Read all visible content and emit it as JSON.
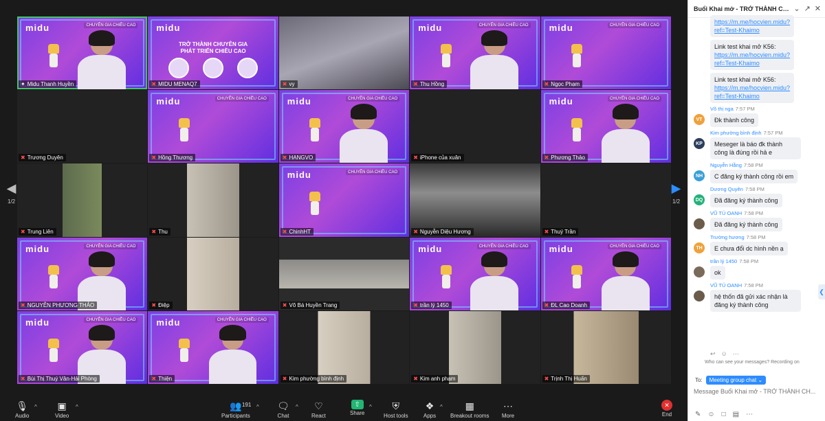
{
  "tiles": [
    {
      "name": "Midu Thanh Huyền",
      "style": "midu",
      "muted": false,
      "pin": true
    },
    {
      "name": "MIDU MENAQ7",
      "style": "poster",
      "muted": false
    },
    {
      "name": "vy",
      "style": "cam1",
      "muted": true
    },
    {
      "name": "Thu Hồng",
      "style": "midu",
      "muted": true
    },
    {
      "name": "Ngọc Phạm",
      "style": "midu",
      "muted": true
    },
    {
      "name": "Trương Duyên",
      "style": "dark",
      "muted": true
    },
    {
      "name": "Hồng Thương",
      "style": "midu",
      "muted": true
    },
    {
      "name": "HANGVO",
      "style": "midu",
      "muted": true
    },
    {
      "name": "iPhone của xuân",
      "style": "dark",
      "muted": true
    },
    {
      "name": "Phương Thảo",
      "style": "midu",
      "muted": true
    },
    {
      "name": "Trung Liên",
      "style": "cam4",
      "muted": true
    },
    {
      "name": "Thu",
      "style": "cam5",
      "muted": true
    },
    {
      "name": "ChinhHT",
      "style": "midu",
      "muted": true
    },
    {
      "name": "Nguyễn Diệu Hương",
      "style": "cam2",
      "muted": true
    },
    {
      "name": "Thuý Trần",
      "style": "dark",
      "muted": true
    },
    {
      "name": "NGUYỄN PHƯƠNG THẢO",
      "style": "midu",
      "muted": true
    },
    {
      "name": "Điệp",
      "style": "cam6",
      "muted": true
    },
    {
      "name": "Võ Bá Huyền Trang",
      "style": "cam3",
      "muted": true
    },
    {
      "name": "trần lý 1450",
      "style": "midu",
      "muted": true
    },
    {
      "name": "ĐL Cao Doanh",
      "style": "midu",
      "muted": true
    },
    {
      "name": "Bùi Thị Thuý Vân-Hải Phòng",
      "style": "midu",
      "muted": true
    },
    {
      "name": "Thiện",
      "style": "midu",
      "muted": true
    },
    {
      "name": "Kim phường bình định",
      "style": "cam6",
      "muted": true
    },
    {
      "name": "Kim anh phạm",
      "style": "cam5",
      "muted": true
    },
    {
      "name": "Trịnh Thị Huấn",
      "style": "cam7",
      "muted": true
    }
  ],
  "poster": {
    "title_line1": "TRỞ THÀNH CHUYÊN GIA",
    "title_line2": "PHÁT TRIỂN CHIỀU CAO"
  },
  "brand": {
    "logo": "midu",
    "tag": "CHUYÊN GIA CHIỀU CAO"
  },
  "pager": {
    "left": "1/2",
    "right": "1/2"
  },
  "toolbar": {
    "audio": "Audio",
    "video": "Video",
    "participants": "Participants",
    "participants_count": "191",
    "chat": "Chat",
    "react": "React",
    "share": "Share",
    "host_tools": "Host tools",
    "apps": "Apps",
    "breakout": "Breakout rooms",
    "more": "More",
    "end": "End"
  },
  "chat": {
    "title": "Buổi Khai mở - TRỞ THÀNH CH...",
    "messages": [
      {
        "type": "link",
        "text": "",
        "link1": "https://m.me/hocvien.midu?",
        "link2": "ref=Test-Khaimo",
        "cont": true
      },
      {
        "type": "link",
        "text": "Link test khai mở K56:",
        "link1": "https://m.me/hocvien.midu?",
        "link2": "ref=Test-Khaimo",
        "cont": true
      },
      {
        "type": "link",
        "text": "Link test khai mở K56:",
        "link1": "https://m.me/hocvien.midu?",
        "link2": "ref=Test-Khaimo",
        "cont": true
      },
      {
        "sender": "Võ thị nga",
        "time": "7:57 PM",
        "initials": "VT",
        "color": "#f0a13a",
        "text": "Đk thành công"
      },
      {
        "sender": "Kim phường bình định",
        "time": "7:57 PM",
        "initials": "KP",
        "color": "#2b3e5c",
        "text": "Meseger là báo đk thành công là đúng rồi hả e"
      },
      {
        "sender": "Nguyễn Hằng",
        "time": "7:58 PM",
        "initials": "NH",
        "color": "#3aa0d8",
        "text": "C đăng ký thành công rồi em"
      },
      {
        "sender": "Dương Quyên",
        "time": "7:58 PM",
        "initials": "DQ",
        "color": "#24b27a",
        "text": "Đã đăng ký thành công"
      },
      {
        "sender": "VŨ TÚ OANH",
        "time": "7:58 PM",
        "initials": "",
        "color": "#6b5b4a",
        "text": "Đã đăng ký thành công"
      },
      {
        "sender": "Trường hương",
        "time": "7:58 PM",
        "initials": "TH",
        "color": "#f0a13a",
        "text": "E chưa đổi dc hình  nền ạ"
      },
      {
        "sender": "trần lý 1450",
        "time": "7:58 PM",
        "initials": "",
        "color": "#7a6a5a",
        "text": "ok"
      },
      {
        "sender": "VŨ TÚ OANH",
        "time": "7:58 PM",
        "initials": "",
        "color": "#6b5b4a",
        "text": "hệ thốn đã gửi xác nhận là đăng ký thành công"
      }
    ],
    "visibility": "Who can see your messages? Recording on",
    "to_label": "To:",
    "to_value": "Meeting group chat ⌄",
    "placeholder": "Message Buổi Khai mở - TRỞ THÀNH CH..."
  }
}
